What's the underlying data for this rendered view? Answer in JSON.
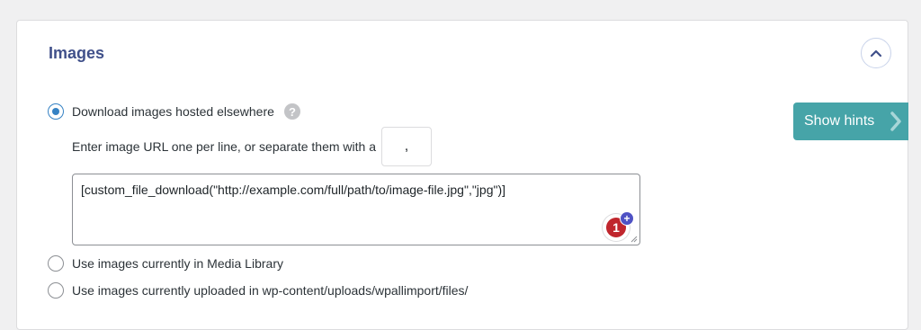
{
  "section": {
    "title": "Images",
    "collapse_icon": "chevron-up-icon"
  },
  "options": {
    "download": {
      "label": "Download images hosted elsewhere",
      "selected": true,
      "help_icon": "question-mark-icon",
      "help_glyph": "?"
    },
    "separator": {
      "label": "Enter image URL one per line, or separate them with a",
      "value": ","
    },
    "url_textarea": {
      "value": "[custom_file_download(\"http://example.com/full/path/to/image-file.jpg\",\"jpg\")]"
    },
    "media_library": {
      "label": "Use images currently in Media Library",
      "selected": false
    },
    "uploaded": {
      "label": "Use images currently uploaded in wp-content/uploads/wpallimport/files/",
      "selected": false
    }
  },
  "badge": {
    "count": "1",
    "plus": "+"
  },
  "hints": {
    "label": "Show hints",
    "icon": "chevron-right-icon"
  },
  "colors": {
    "accent": "#3582c4",
    "title": "#40508a",
    "hints_bg": "#46a4a8",
    "badge_red": "#c0262d",
    "badge_plus": "#4f52c4"
  }
}
